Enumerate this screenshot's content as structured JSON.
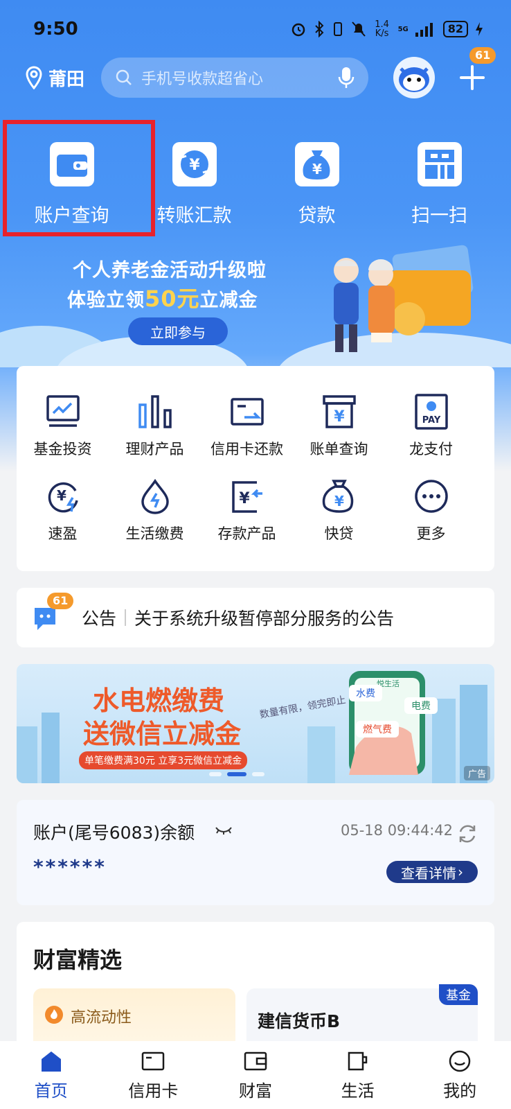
{
  "status_bar": {
    "time": "9:50",
    "net_speed": "1.4\nK/s",
    "signal": "5G",
    "battery": "82"
  },
  "header": {
    "location": "莆田",
    "search_placeholder": "手机号收款超省心",
    "notification_count": "61"
  },
  "quick_actions": [
    {
      "label": "账户查询",
      "icon": "wallet-icon",
      "highlighted": true
    },
    {
      "label": "转账汇款",
      "icon": "transfer-icon"
    },
    {
      "label": "贷款",
      "icon": "loan-bag-icon"
    },
    {
      "label": "扫一扫",
      "icon": "scan-icon"
    }
  ],
  "promo": {
    "line1": "个人养老金活动升级啦",
    "line2_prefix": "体验立领",
    "line2_amount": "50元",
    "line2_suffix": "立减金",
    "button": "立即参与"
  },
  "services": [
    {
      "label": "基金投资",
      "icon": "fund-chart-icon"
    },
    {
      "label": "理财产品",
      "icon": "bar-chart-icon"
    },
    {
      "label": "信用卡还款",
      "icon": "credit-card-repay-icon"
    },
    {
      "label": "账单查询",
      "icon": "bill-icon"
    },
    {
      "label": "龙支付",
      "icon": "long-pay-icon"
    },
    {
      "label": "速盈",
      "icon": "fast-yield-icon"
    },
    {
      "label": "生活缴费",
      "icon": "utility-icon"
    },
    {
      "label": "存款产品",
      "icon": "deposit-icon"
    },
    {
      "label": "快贷",
      "icon": "quick-loan-icon"
    },
    {
      "label": "更多",
      "icon": "more-icon"
    }
  ],
  "notice": {
    "badge": "61",
    "title": "公告",
    "text": "关于系统升级暂停部分服务的公告"
  },
  "banner": {
    "title1": "水电燃缴费",
    "title2": "送微信立减金",
    "subtitle": "单笔缴费满30元 立享3元微信立减金",
    "tag_water": "水费",
    "tag_power": "电费",
    "tag_gas": "燃气费",
    "note": "数量有限，领完即止",
    "ad_label": "广告",
    "phone_label": "悦生活"
  },
  "balance": {
    "label": "账户(尾号6083)余额",
    "masked": "******",
    "timestamp": "05-18 09:44:42",
    "details_button": "查看详情"
  },
  "wealth": {
    "title": "财富精选",
    "card1_tag": "高流动性",
    "card2_name": "建信货币B",
    "card2_badge": "基金"
  },
  "tabs": [
    {
      "label": "首页",
      "icon": "home-icon",
      "active": true
    },
    {
      "label": "信用卡",
      "icon": "card-icon"
    },
    {
      "label": "财富",
      "icon": "wallet-tab-icon"
    },
    {
      "label": "生活",
      "icon": "cup-icon"
    },
    {
      "label": "我的",
      "icon": "profile-icon"
    }
  ],
  "colors": {
    "primary": "#3f8bf2",
    "dark_blue": "#1f3a8a",
    "accent_orange": "#f59a2c",
    "highlight_red": "#e8222b"
  }
}
